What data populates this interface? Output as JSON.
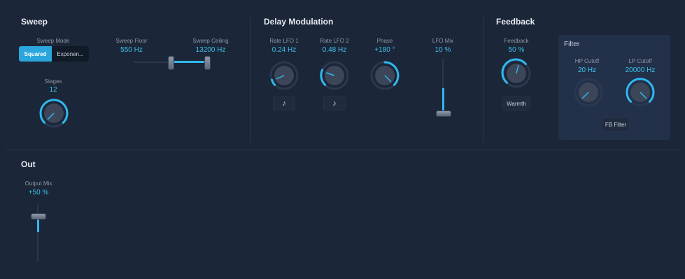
{
  "sweep": {
    "title": "Sweep",
    "mode_label": "Sweep Mode",
    "mode_options": [
      "Squared",
      "Exponen..."
    ],
    "mode_selected": "Squared",
    "floor_label": "Sweep Floor",
    "floor_value": "550 Hz",
    "ceiling_label": "Sweep Ceiling",
    "ceiling_value": "13200 Hz",
    "stages_label": "Stages",
    "stages_value": "12"
  },
  "delay_mod": {
    "title": "Delay Modulation",
    "rate1_label": "Rate LFO 1",
    "rate1_value": "0.24 Hz",
    "rate2_label": "Rate LFO 2",
    "rate2_value": "0.48 Hz",
    "phase_label": "Phase",
    "phase_value": "+180 °",
    "lfomix_label": "LFO Mix",
    "lfomix_value": "10 %",
    "sync_icon": "music-note-icon"
  },
  "feedback": {
    "title": "Feedback",
    "feedback_label": "Feedback",
    "feedback_value": "50 %",
    "warmth_label": "Warmth"
  },
  "filter": {
    "title": "Filter",
    "hp_label": "HP Cutoff",
    "hp_value": "20 Hz",
    "lp_label": "LP Cutoff",
    "lp_value": "20000 Hz",
    "fb_filter_label": "FB Filter"
  },
  "out": {
    "title": "Out",
    "mix_label": "Output Mix",
    "mix_value": "+50 %"
  },
  "colors": {
    "background": "#1b2638",
    "accent": "#2fb8ef",
    "value_text": "#3fc0ea"
  }
}
